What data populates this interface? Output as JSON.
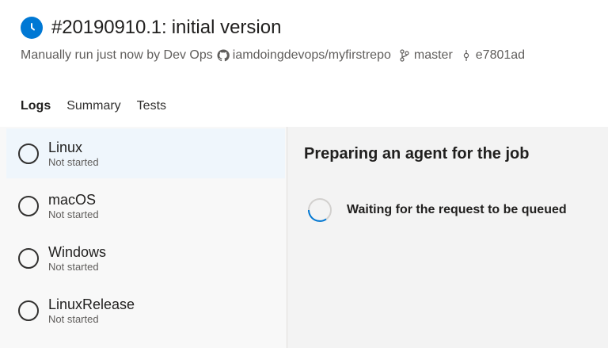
{
  "header": {
    "run_number": "#20190910.1",
    "colon": ":",
    "commit_message": "initial version",
    "trigger_text": "Manually run just now by Dev Ops",
    "repo": "iamdoingdevops/myfirstrepo",
    "branch": "master",
    "commit": "e7801ad"
  },
  "tabs": [
    {
      "label": "Logs",
      "selected": true
    },
    {
      "label": "Summary",
      "selected": false
    },
    {
      "label": "Tests",
      "selected": false
    }
  ],
  "jobs": [
    {
      "name": "Linux",
      "status": "Not started",
      "selected": true
    },
    {
      "name": "macOS",
      "status": "Not started",
      "selected": false
    },
    {
      "name": "Windows",
      "status": "Not started",
      "selected": false
    },
    {
      "name": "LinuxRelease",
      "status": "Not started",
      "selected": false
    }
  ],
  "detail": {
    "title": "Preparing an agent for the job",
    "step_label": "Waiting for the request to be queued"
  },
  "colors": {
    "accent": "#0078d4",
    "selected_bg": "#eff6fc"
  },
  "icons": {
    "status": "clock-icon",
    "repo": "github-icon",
    "branch": "branch-icon",
    "commit": "commit-icon",
    "job": "not-started-circle-icon",
    "step": "spinner-icon"
  }
}
